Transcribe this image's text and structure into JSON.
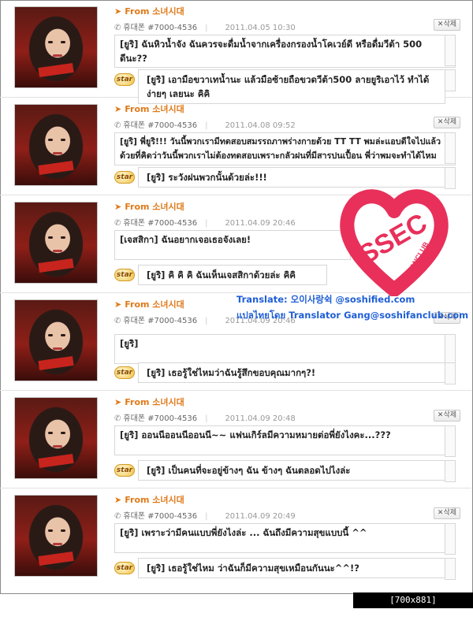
{
  "posts": [
    {
      "from": "From 소녀시대",
      "arrow": "➤",
      "phone_label": "휴대폰 #7000-4536",
      "date": "2011.04.05 10:30",
      "delete_label": "삭제",
      "message": "[ยูริ] ฉันหิวน้ำจัง ฉันควรจะดื่มน้ำจากเครื่องกรองน้ำโคเวย์ดี หรือดื่มวีต้า 500 ดีนะ??",
      "star_label": "star",
      "reply": "[ยูริ] เอามือขวาเทน้ำนะ แล้วมือซ้ายถือขวดวีต้า500 ลายยูริเอาไว้ ทำได้ง่ายๆ เลยนะ คิคิ"
    },
    {
      "from": "From 소녀시대",
      "arrow": "➤",
      "phone_label": "휴대폰 #7000-4536",
      "date": "2011.04.08 09:52",
      "delete_label": "삭제",
      "message": "[ยูริ] พี่ยูริ!!! วันนี้พวกเรามีทดสอบสมรรถภาพร่างกายด้วย TT TT พมล่ะแอบดีใจไปแล้ว ด้วยที่คิดว่าวันนี้พวกเราไม่ต้องทดสอบเพราะกลัวฝนที่มีสารปนเปื้อน พี่ว่าพมจะทำได้ไหม",
      "star_label": "star",
      "reply": "[ยูริ] ระวังฝนพวกนั้นด้วยล่ะ!!!"
    },
    {
      "from": "From 소녀시대",
      "arrow": "➤",
      "phone_label": "휴대폰 #7000-4536",
      "date": "2011.04.09 20:46",
      "delete_label": "삭제",
      "message": "[เจสสิกา] ฉันอยากเจอเธอจังเลย!",
      "star_label": "star",
      "reply": "[ยูริ] คิ คิ คิ ฉันเห็นเจสสิกาด้วยล่ะ คิคิ"
    },
    {
      "from": "From 소녀시대",
      "arrow": "➤",
      "phone_label": "휴대폰 #7000-4536",
      "date": "2011.04.09 20:46",
      "delete_label": "삭제",
      "message": "[ยูริ]",
      "star_label": "star",
      "reply": "[ยูริ] เธอรู้ใช่ไหมว่าฉันรู้สึกขอบคุณมากๆ?!"
    },
    {
      "from": "From 소녀시대",
      "arrow": "➤",
      "phone_label": "휴대폰 #7000-4536",
      "date": "2011.04.09 20:48",
      "delete_label": "삭제",
      "message": "[ยูริ] ออนนีออนนีออนนี~~ แฟนเกิร์ลมีความหมายต่อพี่ยังไงคะ...???",
      "star_label": "star",
      "reply": "[ยูริ] เป็นคนที่จะอยู่ข้างๆ ฉัน ข้างๆ ฉันตลอดไปไงล่ะ"
    },
    {
      "from": "From 소녀시대",
      "arrow": "➤",
      "phone_label": "휴대폰 #7000-4536",
      "date": "2011.04.09 20:49",
      "delete_label": "삭제",
      "message": "[ยูริ] เพราะว่ามีคนแบบพี่ยังไงล่ะ ... ฉันถึงมีความสุขแบบนี้ ^^",
      "star_label": "star",
      "reply": "[ยูริ] เธอรู้ใช่ไหม ว่าฉันก็มีความสุขเหมือนกันนะ^^!?"
    }
  ],
  "logo": {
    "text": "SSEC",
    "subtext": "SOSHIFANCLUB",
    "color": "#e8305a"
  },
  "credits": {
    "line1": "Translate: 오이사랑쉭 @soshified.com",
    "line2": "แปลไทยโดย Translator Gang@soshifanclub.com"
  },
  "watermark": "[700x881] https://upic.me/"
}
